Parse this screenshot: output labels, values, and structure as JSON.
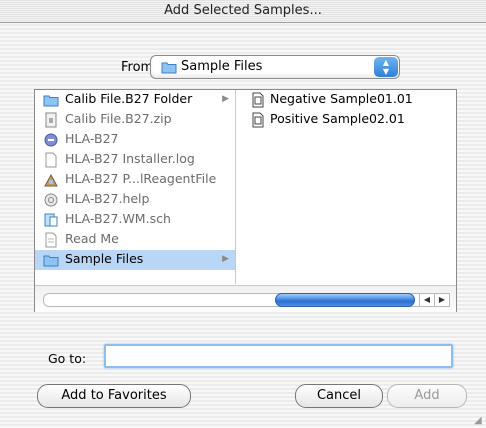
{
  "dialog": {
    "title": "Add Selected Samples..."
  },
  "from": {
    "label": "From:",
    "selected": "Sample Files"
  },
  "browser": {
    "column1": [
      {
        "label": "Calib File.B27 Folder",
        "icon": "folder-icon",
        "dim": false,
        "has_arrow": true,
        "selected": false
      },
      {
        "label": "Calib File.B27.zip",
        "icon": "zip-archive-icon",
        "dim": true,
        "has_arrow": false,
        "selected": false
      },
      {
        "label": "HLA-B27",
        "icon": "application-icon",
        "dim": true,
        "has_arrow": false,
        "selected": false
      },
      {
        "label": "HLA-B27 Installer.log",
        "icon": "document-icon",
        "dim": true,
        "has_arrow": false,
        "selected": false
      },
      {
        "label": "HLA-B27 P...lReagentFile",
        "icon": "reagent-file-icon",
        "dim": true,
        "has_arrow": false,
        "selected": false
      },
      {
        "label": "HLA-B27.help",
        "icon": "help-file-icon",
        "dim": true,
        "has_arrow": false,
        "selected": false
      },
      {
        "label": "HLA-B27.WM.sch",
        "icon": "schedule-file-icon",
        "dim": true,
        "has_arrow": false,
        "selected": false
      },
      {
        "label": "Read Me",
        "icon": "text-document-icon",
        "dim": true,
        "has_arrow": false,
        "selected": false
      },
      {
        "label": "Sample Files",
        "icon": "folder-icon",
        "dim": false,
        "has_arrow": true,
        "selected": true
      }
    ],
    "column2": [
      {
        "label": "Negative Sample01.01",
        "icon": "sample-file-icon"
      },
      {
        "label": "Positive Sample02.01",
        "icon": "sample-file-icon"
      }
    ]
  },
  "goto": {
    "label": "Go to:",
    "value": ""
  },
  "buttons": {
    "favorites": "Add to Favorites",
    "cancel": "Cancel",
    "add": "Add"
  }
}
